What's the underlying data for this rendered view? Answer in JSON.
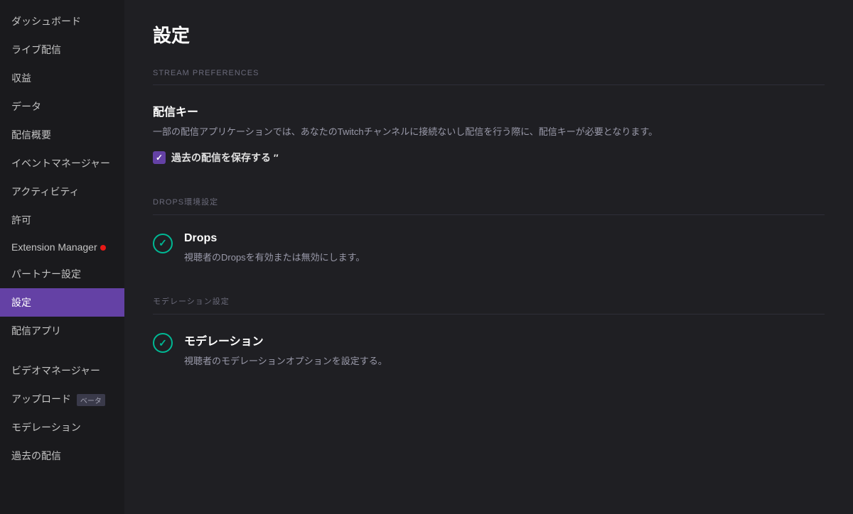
{
  "sidebar": {
    "items": [
      {
        "id": "dashboard",
        "label": "ダッシュボード",
        "active": false
      },
      {
        "id": "live",
        "label": "ライブ配信",
        "active": false
      },
      {
        "id": "revenue",
        "label": "収益",
        "active": false
      },
      {
        "id": "data",
        "label": "データ",
        "active": false
      },
      {
        "id": "stream-summary",
        "label": "配信概要",
        "active": false
      },
      {
        "id": "event-manager",
        "label": "イベントマネージャー",
        "active": false
      },
      {
        "id": "activity",
        "label": "アクティビティ",
        "active": false
      },
      {
        "id": "permissions",
        "label": "許可",
        "active": false
      },
      {
        "id": "extension-manager",
        "label": "Extension Manager",
        "active": false,
        "badge": true
      },
      {
        "id": "partner-settings",
        "label": "パートナー設定",
        "active": false
      },
      {
        "id": "settings",
        "label": "設定",
        "active": true
      },
      {
        "id": "streaming-apps",
        "label": "配信アプリ",
        "active": false
      }
    ],
    "video_section_label": "ビデオマネージャー",
    "video_items": [
      {
        "id": "upload",
        "label": "アップロード",
        "beta": true
      },
      {
        "id": "moderation",
        "label": "モデレーション"
      },
      {
        "id": "past-streams",
        "label": "過去の配信"
      }
    ]
  },
  "main": {
    "page_title": "設定",
    "sections": [
      {
        "id": "stream-preferences",
        "header": "STREAM PREFERENCES",
        "items": [
          {
            "id": "stream-key",
            "title": "配信キー",
            "description": "一部の配信アプリケーションでは、あなたのTwitchチャンネルに接続ないし配信を行う際に、配信キーが必要となります。",
            "checkbox": {
              "checked": true,
              "label": "過去の配信を保存する ″"
            }
          }
        ]
      },
      {
        "id": "drops",
        "header": "DROPS環境設定",
        "items": [
          {
            "id": "drops-item",
            "icon": "check-circle",
            "title": "Drops",
            "description": "視聴者のDropsを有効または無効にします。"
          }
        ]
      },
      {
        "id": "moderation-settings",
        "header": "モデレーション設定",
        "items": [
          {
            "id": "moderation-item",
            "icon": "check-circle",
            "title": "モデレーション",
            "description": "視聴者のモデレーションオプションを設定する。"
          }
        ]
      }
    ]
  }
}
